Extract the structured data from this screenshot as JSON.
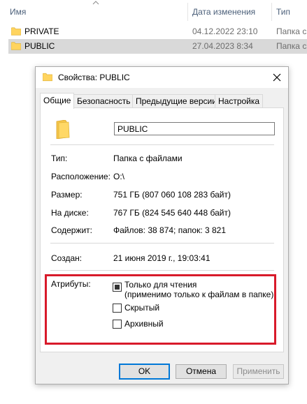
{
  "explorer": {
    "columns": {
      "name": "Имя",
      "date": "Дата изменения",
      "type": "Тип"
    },
    "rows": [
      {
        "name": "PRIVATE",
        "date": "04.12.2022 23:10",
        "type": "Папка с"
      },
      {
        "name": "PUBLIC",
        "date": "27.04.2023 8:34",
        "type": "Папка с"
      }
    ]
  },
  "dialog": {
    "title": "Свойства: PUBLIC",
    "tabs": [
      "Общие",
      "Безопасность",
      "Предыдущие версии",
      "Настройка"
    ],
    "active_tab": "Общие",
    "folder_name": "PUBLIC",
    "props": {
      "type": {
        "label": "Тип:",
        "value": "Папка с файлами"
      },
      "location": {
        "label": "Расположение:",
        "value": "O:\\"
      },
      "size": {
        "label": "Размер:",
        "value": "751 ГБ (807 060 108 283 байт)"
      },
      "size_on_disk": {
        "label": "На диске:",
        "value": "767 ГБ (824 545 640 448 байт)"
      },
      "contains": {
        "label": "Содержит:",
        "value": "Файлов: 38 874; папок: 3 821"
      },
      "created": {
        "label": "Создан:",
        "value": "21 июня 2019 г., 19:03:41"
      }
    },
    "attributes": {
      "label": "Атрибуты:",
      "readonly": {
        "label": "Только для чтения",
        "note": "(применимо только к файлам в папке)",
        "state": "indeterminate"
      },
      "hidden": {
        "label": "Скрытый",
        "checked": false
      },
      "archive": {
        "label": "Архивный",
        "checked": false
      }
    },
    "buttons": {
      "ok": "OK",
      "cancel": "Отмена",
      "apply": "Применить"
    }
  },
  "colors": {
    "highlight": "#d81a2a",
    "folder": "#ffd45f",
    "accent": "#0078d7"
  }
}
